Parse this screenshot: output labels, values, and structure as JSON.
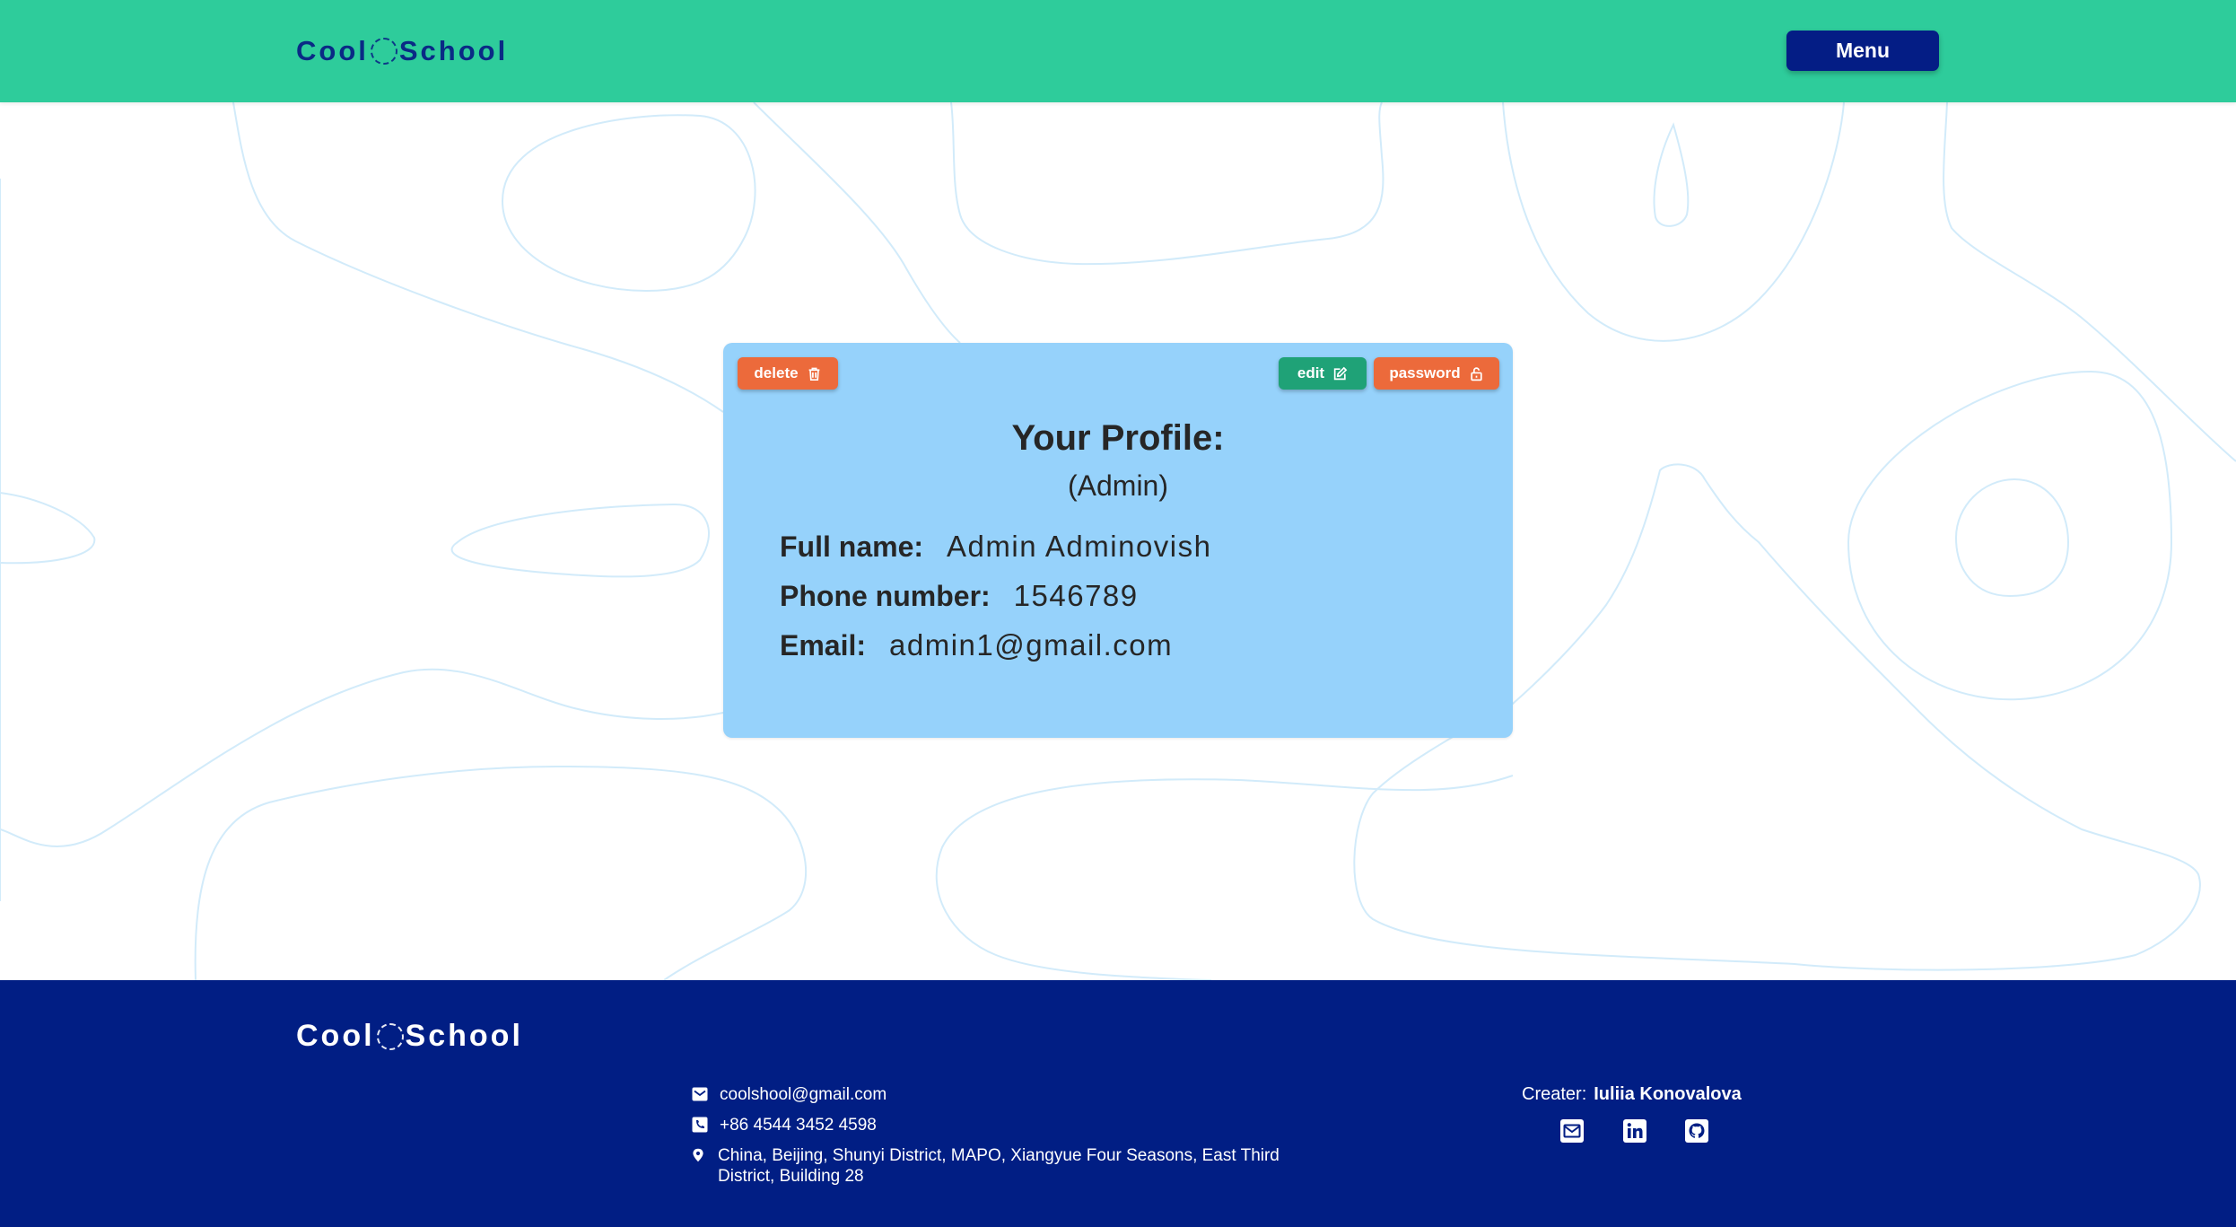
{
  "header": {
    "logo_left": "Cool",
    "logo_right": "School",
    "menu_label": "Menu"
  },
  "profile": {
    "buttons": {
      "delete": "delete",
      "edit": "edit",
      "password": "password"
    },
    "title": "Your Profile:",
    "role": "(Admin)",
    "fields": [
      {
        "label": "Full name:",
        "value": "Admin Adminovish"
      },
      {
        "label": "Phone number:",
        "value": "1546789"
      },
      {
        "label": "Email:",
        "value": "admin1@gmail.com"
      }
    ]
  },
  "footer": {
    "logo_left": "Cool",
    "logo_right": "School",
    "email": "coolshool@gmail.com",
    "phone": "+86 4544 3452 4598",
    "address": "China, Beijing, Shunyi District, MAPO, Xiangyue Four Seasons, East Third District, Building 28",
    "creator_label": "Creater:",
    "creator_name": "Iuliia Konovalova",
    "social_icons": [
      "envelope-icon",
      "linkedin-icon",
      "github-icon"
    ]
  },
  "colors": {
    "header_bg": "#2ecc9b",
    "footer_bg": "#011e84",
    "card_bg": "#96d2fb",
    "menu_button": "#041d85",
    "delete_button": "#ec6a3b",
    "edit_button": "#1fa277",
    "password_button": "#ec6a3b",
    "doodle_lines": "#d2ebfa"
  }
}
